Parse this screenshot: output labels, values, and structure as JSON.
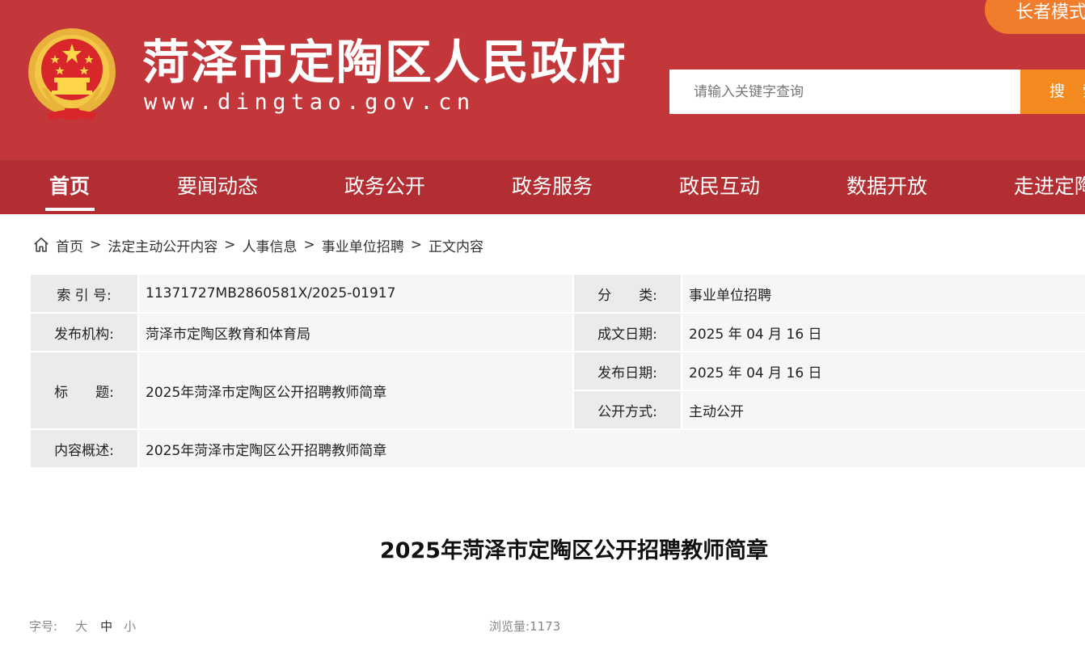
{
  "header": {
    "site_title": "菏泽市定陶区人民政府",
    "site_url": "www.dingtao.gov.cn",
    "elder_mode_label": "长者模式",
    "search_placeholder": "请输入关键字查询",
    "search_button_label": "搜 索",
    "emblem_icon": "national-emblem-icon",
    "colors": {
      "header_bg": "#c3363a",
      "nav_bg": "#b32e32",
      "accent_orange": "#f28a1f"
    }
  },
  "nav": {
    "items": [
      {
        "label": "首页",
        "active": true
      },
      {
        "label": "要闻动态"
      },
      {
        "label": "政务公开"
      },
      {
        "label": "政务服务"
      },
      {
        "label": "政民互动"
      },
      {
        "label": "数据开放"
      },
      {
        "label": "走进定陶"
      }
    ]
  },
  "breadcrumb": {
    "icon": "home-icon",
    "items": [
      "首页",
      "法定主动公开内容",
      "人事信息",
      "事业单位招聘",
      "正文内容"
    ],
    "separator": ">"
  },
  "info_table": {
    "index_label": "索 引 号:",
    "index_value": "11371727MB2860581X/2025-01917",
    "category_label": "分　　类:",
    "category_value": "事业单位招聘",
    "publisher_label": "发布机构:",
    "publisher_value": "菏泽市定陶区教育和体育局",
    "written_date_label": "成文日期:",
    "written_date_value": "2025 年 04 月 16 日",
    "title_label": "标　　题:",
    "title_value": "2025年菏泽市定陶区公开招聘教师简章",
    "publish_date_label": "发布日期:",
    "publish_date_value": "2025 年 04 月 16 日",
    "open_method_label": "公开方式:",
    "open_method_value": "主动公开",
    "summary_label": "内容概述:",
    "summary_value": "2025年菏泽市定陶区公开招聘教师简章"
  },
  "article": {
    "title": "2025年菏泽市定陶区公开招聘教师简章",
    "font_size_label": "字号:",
    "font_sizes": [
      "大",
      "中",
      "小"
    ],
    "views_label": "浏览量:",
    "views": "1173"
  }
}
